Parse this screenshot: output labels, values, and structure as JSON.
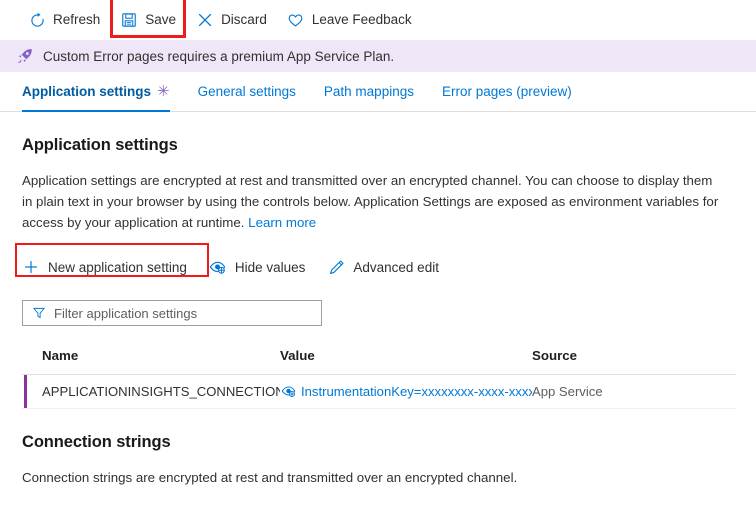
{
  "toolbar": {
    "refresh_label": "Refresh",
    "save_label": "Save",
    "discard_label": "Discard",
    "feedback_label": "Leave Feedback"
  },
  "banner": {
    "message": "Custom Error pages requires a premium App Service Plan."
  },
  "tabs": [
    {
      "label": "Application settings",
      "active": true,
      "dirty": "✳"
    },
    {
      "label": "General settings",
      "active": false
    },
    {
      "label": "Path mappings",
      "active": false
    },
    {
      "label": "Error pages (preview)",
      "active": false
    }
  ],
  "app_settings": {
    "title": "Application settings",
    "description_part1": "Application settings are encrypted at rest and transmitted over an encrypted channel. You can choose to display them in plain text in your browser by using the controls below. Application Settings are exposed as environment variables for access by your application at runtime. ",
    "learn_more": "Learn more",
    "actions": {
      "new_setting": "New application setting",
      "hide_values": "Hide values",
      "advanced_edit": "Advanced edit"
    },
    "filter": {
      "placeholder": "Filter application settings",
      "value": ""
    },
    "columns": {
      "name": "Name",
      "value": "Value",
      "source": "Source"
    },
    "rows": [
      {
        "name": "APPLICATIONINSIGHTS_CONNECTION_STRING",
        "value": "InstrumentationKey=xxxxxxxx-xxxx-xxxx-xxxx-xxxxxxxxxxxx",
        "source": "App Service"
      }
    ]
  },
  "connection_strings": {
    "title": "Connection strings",
    "description": "Connection strings are encrypted at rest and transmitted over an encrypted channel."
  },
  "colors": {
    "accent_blue": "#0078d4",
    "annotation_red": "#ef1c1c",
    "banner_purple_bg": "#efe6f7",
    "rocket_purple": "#8661c5",
    "row_accent_purple": "#8c2fa0",
    "dirty_asterisk_purple": "#8661c5"
  }
}
